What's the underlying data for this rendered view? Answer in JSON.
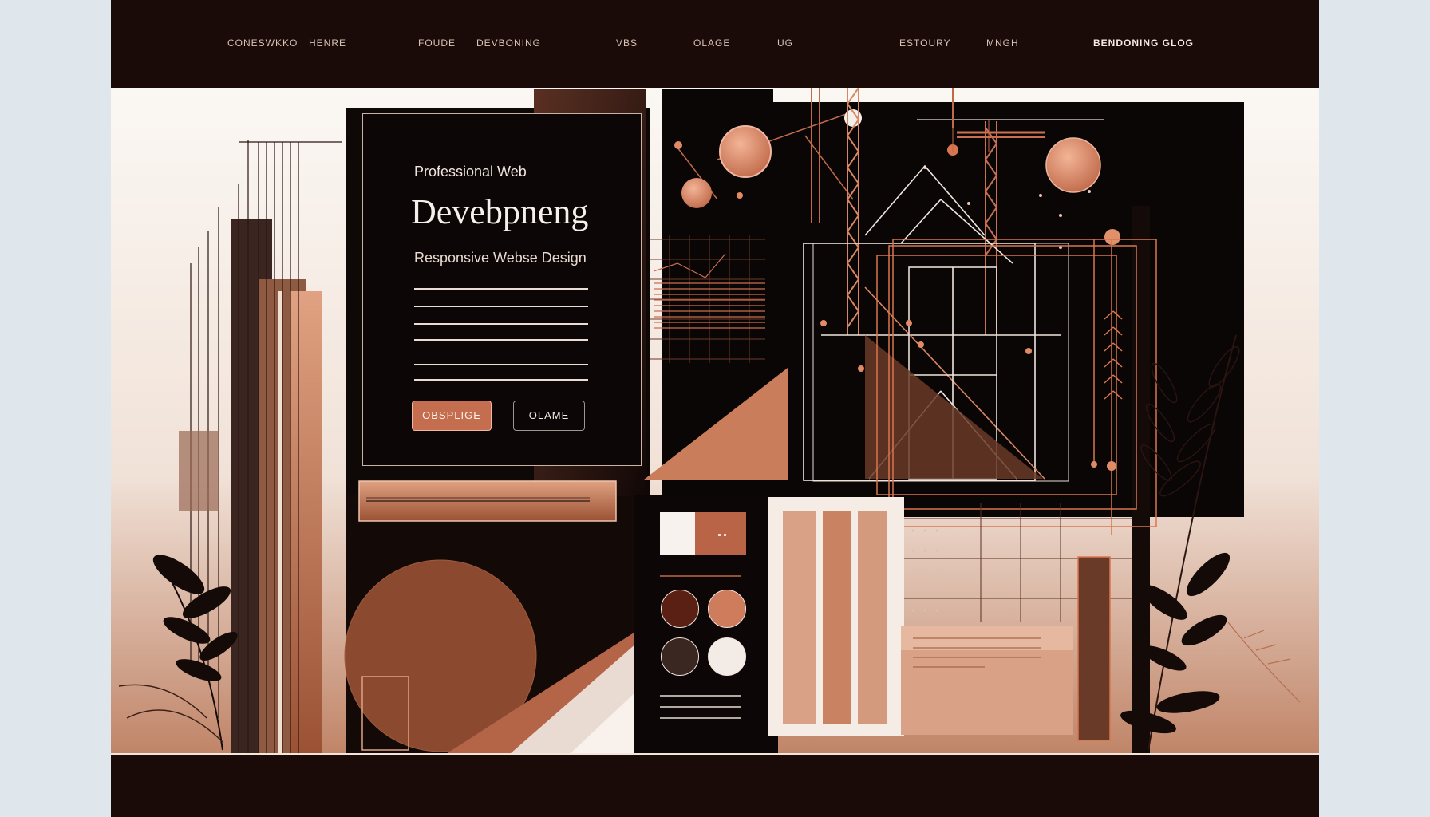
{
  "nav": {
    "items": [
      "CONESWKKO",
      "HENRE",
      "FOUDE",
      "DEVBONING",
      "VBS",
      "OLAGE",
      "UG",
      "ESTOURY",
      "MNGH"
    ],
    "brand": "BENDONING GLOG"
  },
  "hero": {
    "kicker": "Professional Web",
    "title": "Devebpneng",
    "subtitle": "Responsive Webse Design",
    "primary_button": "OBSPLIGE",
    "secondary_button": "OLAME"
  },
  "palette": {
    "colors": [
      "#5a2014",
      "#cf7c5d",
      "#3a2722",
      "#f3ece6"
    ]
  },
  "theme": {
    "dark": "#1a0a08",
    "copper": "#c46e4f",
    "cream": "#f3ece6"
  }
}
